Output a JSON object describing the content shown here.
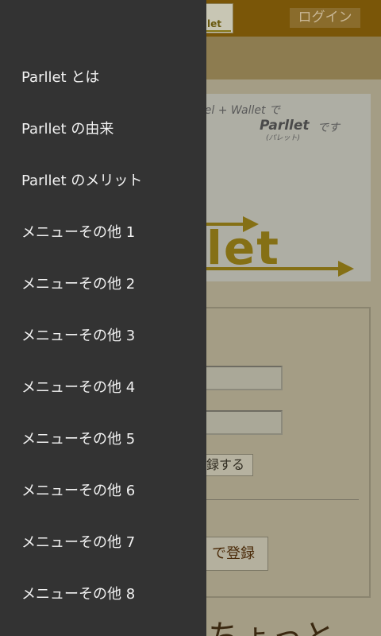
{
  "header": {
    "login_label": "ログイン",
    "logo_thumb_text": "let"
  },
  "hero": {
    "tagline_line1": "llel + Wallet で",
    "brand": "Parllet",
    "brand_suffix": "です",
    "brand_reading": "(パレット)",
    "logo_text": "let"
  },
  "form": {
    "register_button_label": "録する",
    "quick_register_label": "で登録"
  },
  "footer_text": "ちょっと",
  "drawer": {
    "items": [
      {
        "label": "Parllet とは"
      },
      {
        "label": "Parllet の由来"
      },
      {
        "label": "Parllet のメリット"
      },
      {
        "label": "メニューその他 1"
      },
      {
        "label": "メニューその他 2"
      },
      {
        "label": "メニューその他 3"
      },
      {
        "label": "メニューその他 4"
      },
      {
        "label": "メニューその他 5"
      },
      {
        "label": "メニューその他 6"
      },
      {
        "label": "メニューその他 7"
      },
      {
        "label": "メニューその他 8"
      }
    ]
  },
  "colors": {
    "drawer_bg": "#333333",
    "topbar": "#7a5608",
    "page_bg": "#a49d85",
    "brand_gold": "#857015"
  }
}
